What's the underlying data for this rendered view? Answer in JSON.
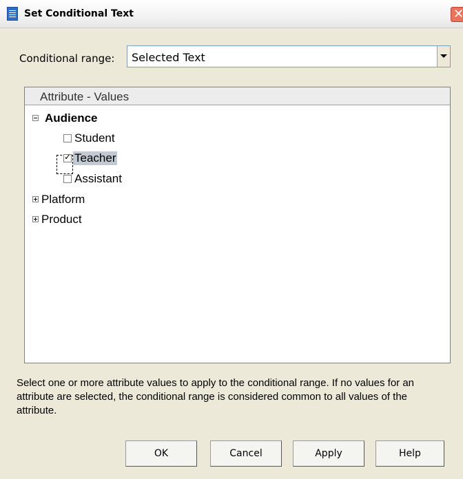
{
  "window": {
    "title": "Set Conditional Text",
    "close_symbol": "✕"
  },
  "range": {
    "label": "Conditional range:",
    "selected": "Selected Text"
  },
  "tree": {
    "header": "Attribute - Values",
    "nodes": [
      {
        "label": "Audience",
        "expanded": true,
        "children": [
          {
            "label": "Student",
            "checked": false
          },
          {
            "label": "Teacher",
            "checked": true
          },
          {
            "label": "Assistant",
            "checked": false
          }
        ]
      },
      {
        "label": "Platform",
        "expanded": false
      },
      {
        "label": "Product",
        "expanded": false
      }
    ]
  },
  "help_text": "Select one or more attribute values to apply to the conditional range. If no values for an attribute are selected, the conditional range is considered common to all values of the attribute.",
  "buttons": {
    "ok": "OK",
    "cancel": "Cancel",
    "apply": "Apply",
    "help": "Help"
  }
}
